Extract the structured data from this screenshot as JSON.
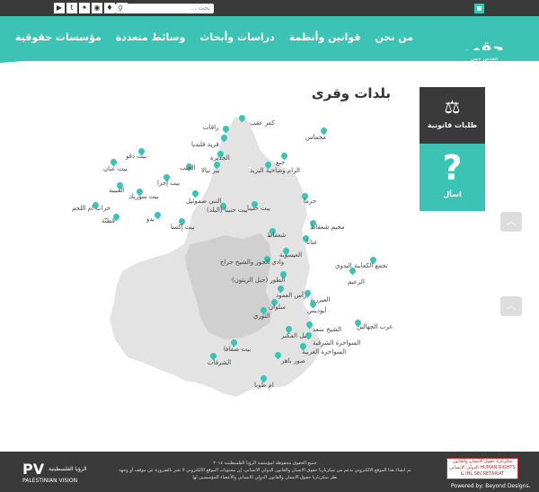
{
  "header": {
    "search_placeholder": "بحث ...",
    "nav_items": [
      "من نحن",
      "قوانين وأنظمة",
      "دراسات وأبحاث",
      "وسائط متعددة",
      "مؤسسات حقوقية"
    ],
    "logo_main": "حقي",
    "logo_sub": "القدس حقي"
  },
  "page": {
    "title": "بلدات وقرى"
  },
  "side": {
    "legal_requests": "طلبات قانونية",
    "ask": "اسأل"
  },
  "locations": [
    "رافات",
    "كفر عقب",
    "مخماس",
    "قرية قلنديا",
    "الجديرة",
    "جبع",
    "بير نبالا",
    "الرام وضاحية البريد",
    "الجيب",
    "بيت دقو",
    "بيت عنان",
    "بيت إجزا",
    "القبيبة",
    "بيت سوريك",
    "النبي صموئيل",
    "حزما",
    "بيت حنينا",
    "بيت حنينا (البلد)",
    "بدو",
    "خراب ام اللحم",
    "قطنّة",
    "بيت إكسا",
    "مخيم شعفاط",
    "شعفاط",
    "عناتا",
    "العيسوية",
    "تجمع الكعابنة البدوي",
    "وادي الجوز والشيخ جراح",
    "الزعيم",
    "الطور (جبل الزيتون)",
    "العيزرية",
    "رأس العمود",
    "سلوان",
    "أبوديس",
    "الثوري",
    "عرب الجهالين",
    "جبل المكبر",
    "الشيخ سعد",
    "السواحرة الشرقية",
    "السواحرة الغربية",
    "بيت صفافا",
    "الشرفات",
    "صور باهر",
    "ام طوبا"
  ],
  "footer": {
    "line1": "جميع الحقوق محفوظة لمؤسسة الرؤيا الفلسطينية ٢٠١٤",
    "line2": "تم انشاء هذا الموقع الالكتروني بدعم من سكرتاريا حقوق الانسان والقانون الدولي الانساني. إن محتويات الموقع الالكتروني لا تعبر بالضرورة عن موقف أو وجهة نظر سكرتاريا حقوق الانسان والقانون الدولي الانساني والأعضاء المؤسسين لها",
    "org_ar": "الرؤيا الفلسطينية",
    "org_en": "PALESTINIAN VISION",
    "partner": "سكرتاريا حقوق الانسان والقانون الدولي الانساني HUMAN RIGHTS & IHL SECRETARIAT",
    "powered": "Powered by: Beyond Designs."
  },
  "colors": {
    "accent": "#3cc3b3",
    "dark": "#3a3a3a",
    "map": "#e3e3e3"
  },
  "icons": [
    "youtube-icon",
    "tumblr-icon",
    "twitter-icon",
    "rss-icon",
    "bookmark-icon",
    "facebook-icon",
    "search-icon",
    "scales-icon",
    "question-icon",
    "chevron-up-icon"
  ]
}
